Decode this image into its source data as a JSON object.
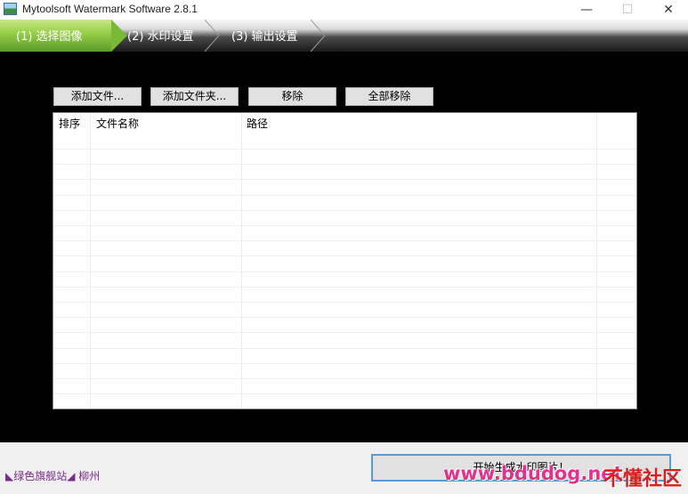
{
  "window": {
    "title": "Mytoolsoft Watermark Software 2.8.1",
    "minimize_glyph": "—",
    "maximize_glyph": "☐",
    "close_glyph": "✕"
  },
  "wizard": {
    "steps": [
      {
        "label": "(1) 选择图像",
        "active": true
      },
      {
        "label": "(2) 水印设置",
        "active": false
      },
      {
        "label": "(3) 输出设置",
        "active": false
      }
    ]
  },
  "toolbar": {
    "add_file": "添加文件...",
    "add_folder": "添加文件夹...",
    "remove": "移除",
    "remove_all": "全部移除"
  },
  "file_list": {
    "columns": [
      "排序",
      "文件名称",
      "路径"
    ],
    "rows": []
  },
  "footer": {
    "brand_text": "◣绿色旗舰站◢ 柳州",
    "start_button": "开始生成水印图片！"
  },
  "overlay_watermark": {
    "text": "www.bdudog.net",
    "text2": "不懂社区"
  },
  "colors": {
    "accent_green": "#9ad04a",
    "workarea_bg": "#000000",
    "brand_purple": "#7a2a8a"
  }
}
